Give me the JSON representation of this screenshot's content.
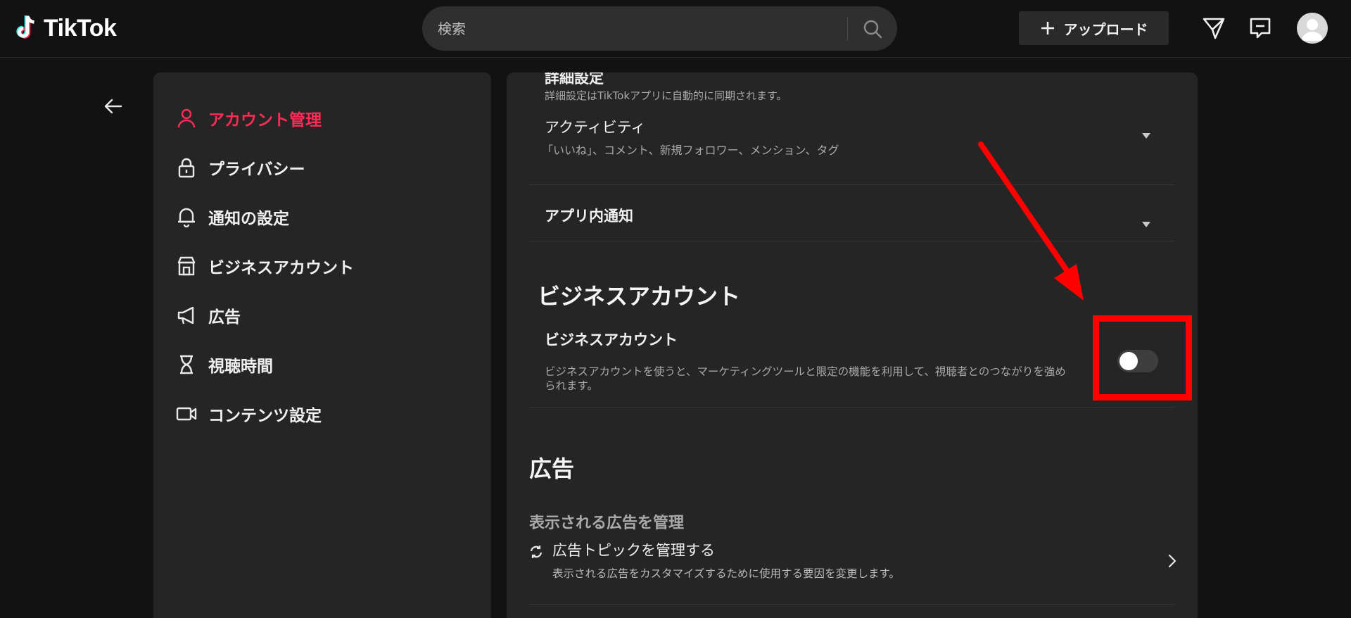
{
  "header": {
    "logo_text": "TikTok",
    "search": {
      "placeholder": "検索"
    },
    "upload_label": "アップロード",
    "icons": [
      "tiktok-logo-icon",
      "search-icon",
      "plus-icon",
      "send-icon",
      "inbox-icon",
      "avatar"
    ]
  },
  "sidebar": {
    "items": [
      {
        "label": "アカウント管理",
        "icon": "person-icon",
        "active": true
      },
      {
        "label": "プライバシー",
        "icon": "lock-icon"
      },
      {
        "label": "通知の設定",
        "icon": "bell-icon"
      },
      {
        "label": "ビジネスアカウント",
        "icon": "store-icon"
      },
      {
        "label": "広告",
        "icon": "megaphone-icon"
      },
      {
        "label": "視聴時間",
        "icon": "hourglass-icon"
      },
      {
        "label": "コンテンツ設定",
        "icon": "video-camera-icon"
      }
    ]
  },
  "main": {
    "advanced": {
      "title": "詳細設定",
      "description": "詳細設定はTikTokアプリに自動的に同期されます。"
    },
    "activity": {
      "title": "アクティビティ",
      "description": "「いいね」、コメント、新規フォロワー、メンション、タグ"
    },
    "in_app": {
      "title": "アプリ内通知"
    },
    "business_section": {
      "heading": "ビジネスアカウント",
      "row_title": "ビジネスアカウント",
      "description_line1": "ビジネスアカウントを使うと、マーケティングツールと限定の機能を利用して、視聴者とのつながりを強め",
      "description_line2": "られます。",
      "toggle_on": false
    },
    "ads_section": {
      "heading": "広告",
      "subheading": "表示される広告を管理",
      "topics_title": "広告トピックを管理する",
      "topics_description": "表示される広告をカスタマイズするために使用する要因を変更します。"
    }
  },
  "colors": {
    "background": "#121212",
    "panel": "#252525",
    "accent": "#fe2c55",
    "annotation": "#ff0000"
  }
}
